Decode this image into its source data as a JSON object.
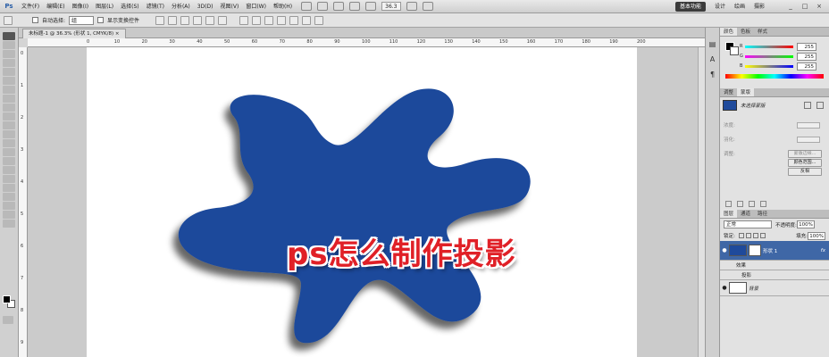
{
  "app": {
    "logo": "Ps",
    "menus": [
      "文件(F)",
      "编辑(E)",
      "图像(I)",
      "图层(L)",
      "选择(S)",
      "滤镜(T)",
      "分析(A)",
      "3D(D)",
      "视图(V)",
      "窗口(W)",
      "帮助(H)"
    ],
    "zoom_display": "36.3",
    "workspace_active": "基本功能",
    "workspaces": [
      "设计",
      "绘画",
      "摄影"
    ],
    "window_buttons": [
      "_",
      "□",
      "×"
    ]
  },
  "options": {
    "auto_select_label": "自动选择:",
    "auto_select_value": "组",
    "transform_label": "显示变换控件"
  },
  "document": {
    "tab_title": "未标题-1 @ 36.3% (形状 1, CMYK/8) ×",
    "headline": "ps怎么制作投影",
    "shape_color": "#1f4a9b",
    "ruler_h": [
      "0",
      "10",
      "20",
      "30",
      "40",
      "50",
      "60",
      "70",
      "80",
      "90",
      "100",
      "110",
      "120",
      "130",
      "140",
      "150",
      "160",
      "170",
      "180",
      "190",
      "200"
    ],
    "ruler_v": [
      "0",
      "1",
      "2",
      "3",
      "4",
      "5",
      "6",
      "7",
      "8",
      "9"
    ]
  },
  "color_panel": {
    "tabs": [
      "颜色",
      "色板",
      "样式"
    ],
    "sliders": [
      {
        "label": "R",
        "value": "255",
        "color": "#e03030"
      },
      {
        "label": "G",
        "value": "255",
        "color": "#30c030"
      },
      {
        "label": "B",
        "value": "255",
        "color": "#3050e0"
      }
    ]
  },
  "adjust_panel": {
    "tabs": [
      "调整",
      "蒙版"
    ],
    "mask_title": "未选择蒙版",
    "density_label": "浓度:",
    "feather_label": "羽化:",
    "refine_label": "调整:",
    "buttons": [
      "蒙版边缘...",
      "颜色范围...",
      "反相"
    ]
  },
  "layers_panel": {
    "tabs": [
      "图层",
      "通道",
      "路径"
    ],
    "blend_mode": "正常",
    "opacity_label": "不透明度:",
    "opacity_value": "100%",
    "lock_label": "锁定:",
    "fill_label": "填充:",
    "fill_value": "100%",
    "layers": [
      {
        "name": "形状 1",
        "fx": "fx"
      },
      {
        "name": "效果"
      },
      {
        "name": "投影"
      },
      {
        "name": "背景"
      }
    ]
  }
}
